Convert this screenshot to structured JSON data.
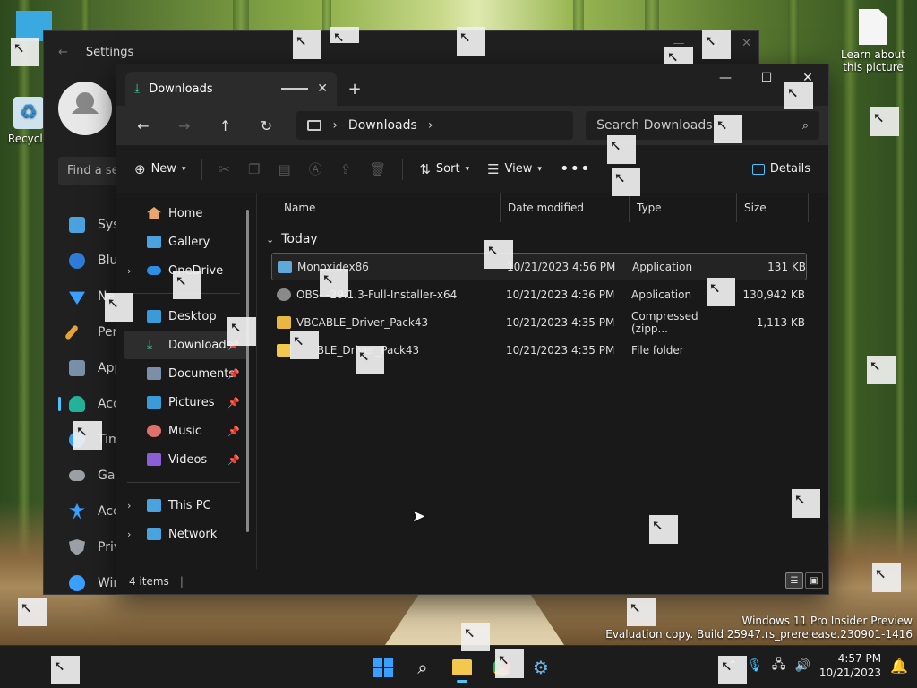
{
  "desktop": {
    "recycle_label": "Recycle",
    "learn_label_1": "Learn about",
    "learn_label_2": "this picture"
  },
  "settings": {
    "title": "Settings",
    "find_placeholder": "Find a se",
    "nav": [
      {
        "label": "Syst",
        "color": "#4aa3df"
      },
      {
        "label": "Blue",
        "color": "#2f7bd8"
      },
      {
        "label": "Ne",
        "color": "#3aa0ff"
      },
      {
        "label": "Pers",
        "color": "#e8a23a"
      },
      {
        "label": "App",
        "color": "#7a8fa8"
      },
      {
        "label": "Acc",
        "color": "#23b39a"
      },
      {
        "label": "Tim",
        "color": "#3aa0ff"
      },
      {
        "label": "Gar",
        "color": "#9aa0a6"
      },
      {
        "label": "Acc",
        "color": "#3aa0ff"
      },
      {
        "label": "Priv",
        "color": "#9aa0a6"
      },
      {
        "label": "Wir",
        "color": "#3aa0ff"
      }
    ]
  },
  "explorer": {
    "tab_label": "Downloads",
    "address_segment": "Downloads",
    "search_placeholder": "Search Downloads",
    "commands": {
      "new": "New",
      "sort": "Sort",
      "view": "View",
      "details": "Details"
    },
    "sidebar": {
      "home": "Home",
      "gallery": "Gallery",
      "onedrive": "OneDrive",
      "desktop": "Desktop",
      "downloads": "Downloads",
      "documents": "Documents",
      "pictures": "Pictures",
      "music": "Music",
      "videos": "Videos",
      "this_pc": "This PC",
      "network": "Network"
    },
    "columns": {
      "name": "Name",
      "date": "Date modified",
      "type": "Type",
      "size": "Size"
    },
    "group_label": "Today",
    "files": [
      {
        "name": "Monoxidex86",
        "date": "10/21/2023 4:56 PM",
        "type": "Application",
        "size": "131 KB",
        "icon_color": "#5fa8d8"
      },
      {
        "name": "OBS-       -29.1.3-Full-Installer-x64",
        "date": "10/21/2023 4:36 PM",
        "type": "Application",
        "size": "130,942 KB",
        "icon_color": "#8a8a8a"
      },
      {
        "name": "VBCABLE_Driver_Pack43",
        "date": "10/21/2023 4:35 PM",
        "type": "Compressed (zipp...",
        "size": "1,113 KB",
        "icon_color": "#e9b840"
      },
      {
        "name": "      BLE_Driver_Pack43",
        "date": "10/21/2023 4:35 PM",
        "type": "File folder",
        "size": "",
        "icon_color": "#f2c94c"
      }
    ],
    "status": "4 items"
  },
  "watermark": {
    "line1": "Windows 11 Pro Insider Preview",
    "line2": "Evaluation copy. Build 25947.rs_prerelease.230901-1416"
  },
  "taskbar": {
    "time": "4:57 PM",
    "date": "10/21/2023"
  }
}
